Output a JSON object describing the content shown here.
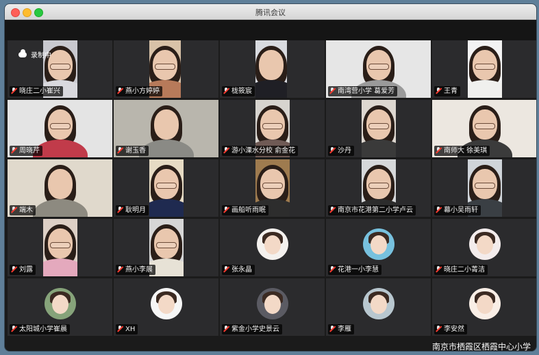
{
  "window": {
    "title": "腾讯会议"
  },
  "recording": {
    "label": "录制中"
  },
  "watermark": "南京市栖霞区栖霞中心小学",
  "participants": [
    {
      "name": "晓庄二小崔兴",
      "type": "video",
      "bg": "#c9c9cf",
      "shirt": "#d9d9de",
      "glasses": true
    },
    {
      "name": "燕小方婷婷",
      "type": "video",
      "bg": "#d8c2a8",
      "shirt": "#b77a5a",
      "glasses": true
    },
    {
      "name": "栊筱宸",
      "type": "video",
      "bg": "#d9dbe0",
      "shirt": "#1f1f25",
      "glasses": false
    },
    {
      "name": "南湾营小学 葛爱芳",
      "type": "video",
      "bg": "#e6e6e6",
      "shirt": "#9a9a9a",
      "glasses": true
    },
    {
      "name": "王青",
      "type": "video",
      "bg": "#f3f3f3",
      "shirt": "#f0f0ee",
      "glasses": true
    },
    {
      "name": "周晓芹",
      "type": "video",
      "bg": "#e4e4e4",
      "shirt": "#c13b4a",
      "glasses": true
    },
    {
      "name": "谢玉香",
      "type": "video",
      "bg": "#b9b6ad",
      "shirt": "#8a8a85",
      "glasses": false
    },
    {
      "name": "游小溧水分校 俞金花",
      "type": "video",
      "bg": "#d7d4cf",
      "shirt": "#6f5a55",
      "glasses": true
    },
    {
      "name": "沙丹",
      "type": "video",
      "bg": "#ddd7d0",
      "shirt": "#3a3a3a",
      "glasses": true
    },
    {
      "name": "南师大 徐美琪",
      "type": "video",
      "bg": "#ece7e0",
      "shirt": "#3b3b3b",
      "glasses": true
    },
    {
      "name": "端木",
      "type": "video",
      "bg": "#e0d9cc",
      "shirt": "#8d8a80",
      "glasses": false
    },
    {
      "name": "耿明月",
      "type": "video",
      "bg": "#e6dbc4",
      "shirt": "#1f2a50",
      "glasses": true
    },
    {
      "name": "画船听雨眠",
      "type": "video",
      "bg": "#9e7b4f",
      "shirt": "#2d2d2d",
      "glasses": true
    },
    {
      "name": "南京市花港第二小学卢云",
      "type": "video",
      "bg": "#d6d8da",
      "shirt": "#2c2c2c",
      "glasses": true
    },
    {
      "name": "幕小吴雨轩",
      "type": "video",
      "bg": "#cfd4d9",
      "shirt": "#3a3f44",
      "glasses": true
    },
    {
      "name": "刘露",
      "type": "video",
      "bg": "#ddd0c6",
      "shirt": "#e4a9bd",
      "glasses": true
    },
    {
      "name": "燕小李展",
      "type": "video",
      "bg": "#d6d6d6",
      "shirt": "#e7e2d6",
      "glasses": true
    },
    {
      "name": "张永晶",
      "type": "avatar",
      "avatar_bg": "#f4f1ee"
    },
    {
      "name": "花港一小李慧",
      "type": "avatar",
      "avatar_bg": "#77c1de"
    },
    {
      "name": "晓庄二小菁洁",
      "type": "avatar",
      "avatar_bg": "#f3ecec"
    },
    {
      "name": "太阳城小学崔晨",
      "type": "avatar",
      "avatar_bg": "#86a37a"
    },
    {
      "name": "XH",
      "type": "avatar",
      "avatar_bg": "#f6f6f6"
    },
    {
      "name": "紫金小学史景云",
      "type": "avatar",
      "avatar_bg": "#5b5b63"
    },
    {
      "name": "李雁",
      "type": "avatar",
      "avatar_bg": "#b8c7cf"
    },
    {
      "name": "李安然",
      "type": "avatar",
      "avatar_bg": "#f9eee6"
    }
  ]
}
